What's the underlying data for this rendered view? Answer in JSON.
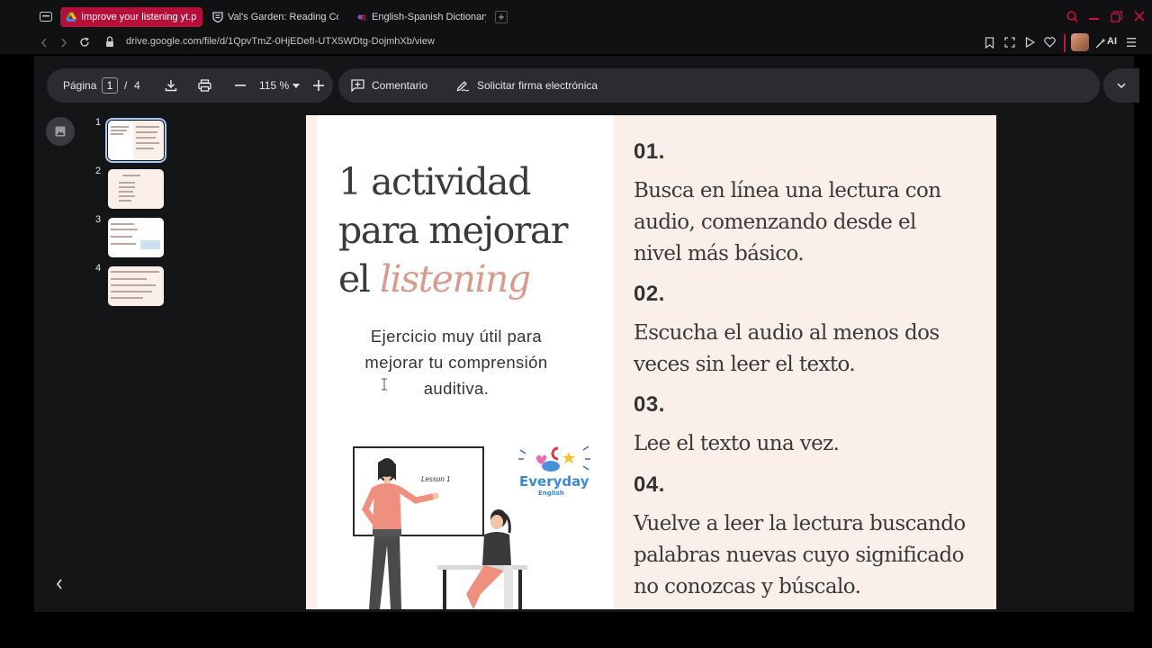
{
  "browser": {
    "tabs": [
      {
        "label": "Improve your listening yt.p",
        "active": true
      },
      {
        "label": "Val's Garden: Reading Co",
        "active": false
      },
      {
        "label": "English-Spanish Dictionary",
        "active": false
      }
    ],
    "new_tab_symbol": "+",
    "url": "drive.google.com/file/d/1QpvTmZ-0HjEDefI-UTX5WDtg-DojmhXb/view",
    "ai_label": "AI",
    "accent_color": "#b5103a"
  },
  "toolbar": {
    "page_label": "Página",
    "page_current": "1",
    "page_separator": "/",
    "page_total": "4",
    "zoom": "115 %",
    "comment_label": "Comentario",
    "signature_label": "Solicitar firma electrónica"
  },
  "thumbnails": [
    {
      "number": "1",
      "selected": true
    },
    {
      "number": "2",
      "selected": false
    },
    {
      "number": "3",
      "selected": false
    },
    {
      "number": "4",
      "selected": false
    }
  ],
  "document": {
    "title_line1": "1 actividad",
    "title_line2": "para mejorar",
    "title_line3_prefix": "el",
    "title_line3_emphasis": "listening",
    "subtitle_line1": "Ejercicio muy útil para",
    "subtitle_line2": "mejorar tu comprensión",
    "subtitle_line3": "auditiva.",
    "board_text": "Lesson 1",
    "logo_main": "Everyday",
    "logo_sub": "English",
    "steps": [
      {
        "number": "01.",
        "lines": [
          "Busca en línea una lectura con",
          "audio, comenzando desde el",
          "nivel más básico."
        ]
      },
      {
        "number": "02.",
        "lines": [
          "Escucha el audio al menos dos",
          "veces sin leer el texto."
        ]
      },
      {
        "number": "03.",
        "lines": [
          "Lee el texto una vez."
        ]
      },
      {
        "number": "04.",
        "lines": [
          "Vuelve a leer la lectura buscando",
          "palabras nuevas cuyo significado",
          "no conozcas y búscalo."
        ]
      }
    ],
    "accent_color": "#d99a90",
    "background_color": "#fbefe9"
  }
}
